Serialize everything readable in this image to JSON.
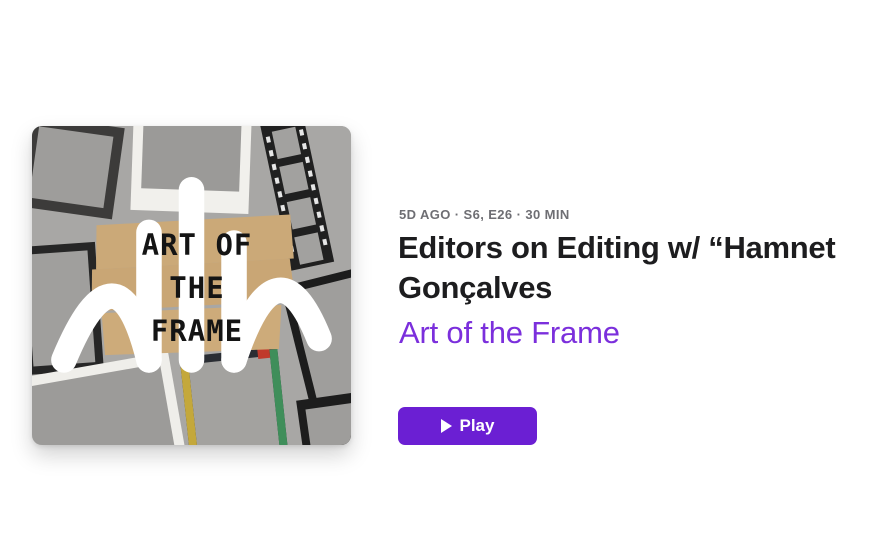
{
  "episode": {
    "meta": "5D AGO · S6, E26 · 30 MIN",
    "title": "Editors on Editing w/ “Hamnet\nGonçalves",
    "show": "Art of the Frame"
  },
  "artwork": {
    "title_text": "ART OF\nTHE\nFRAME",
    "badge_icon": "podcast-waveform-icon"
  },
  "actions": {
    "play_label": "Play"
  },
  "colors": {
    "accent": "#7b2fdc",
    "play_button": "#6b1fd3",
    "meta_text": "#6e6e73",
    "title_text": "#1d1d1f"
  }
}
